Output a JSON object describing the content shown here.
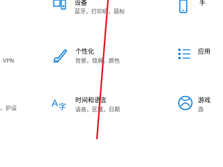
{
  "settings": {
    "row1": {
      "col2": {
        "title": "设备",
        "desc": "蓝牙，打印机，鼠标",
        "icon": "devices-icon"
      },
      "col3": {
        "title": "手",
        "icon": "phone-icon"
      }
    },
    "row2": {
      "col1": {
        "desc": "VPN"
      },
      "col2": {
        "title": "个性化",
        "desc": "背景，锁屏，颜色",
        "icon": "personalization-icon"
      },
      "col3": {
        "title": "应用",
        "icon": "apps-icon"
      }
    },
    "row3": {
      "col1": {
        "desc": "，护设"
      },
      "col2": {
        "title": "时间和语言",
        "desc": "语音，区域，日期",
        "icon": "time-language-icon"
      },
      "col3": {
        "title": "游戏",
        "desc": "游",
        "icon": "xbox-icon"
      }
    }
  },
  "colors": {
    "accent": "#0078d7",
    "annotation_line": "#e0151c"
  }
}
